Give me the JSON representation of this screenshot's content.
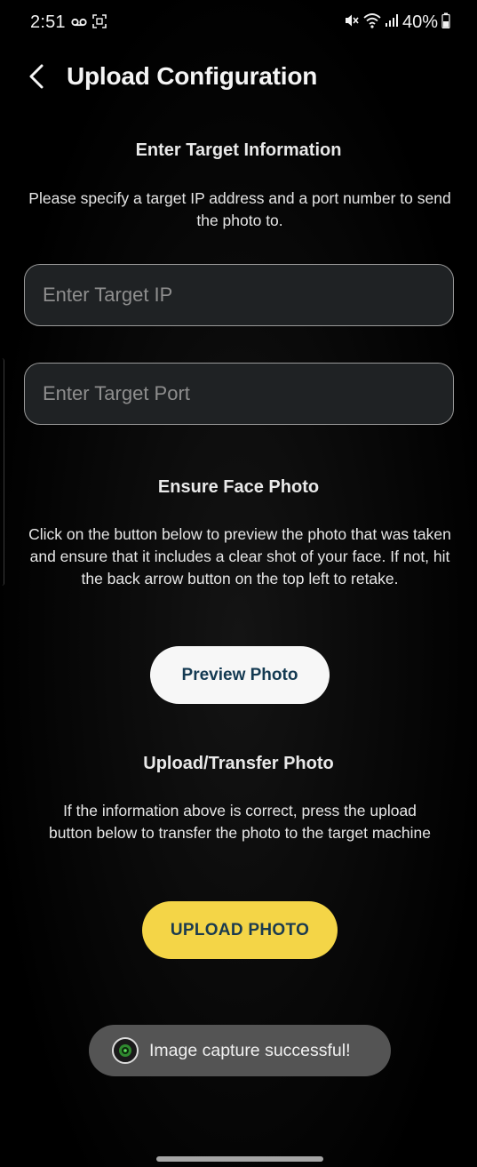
{
  "status_bar": {
    "time": "2:51",
    "battery": "40%",
    "icons": [
      "voicemail-icon",
      "screenshot-icon",
      "mute-icon",
      "wifi-icon",
      "signal-icon",
      "battery-icon"
    ]
  },
  "app_bar": {
    "title": "Upload Configuration",
    "back_icon": "back-arrow-icon"
  },
  "target_section": {
    "heading": "Enter Target Information",
    "description": "Please specify a target IP address and a port number to send the photo to.",
    "ip_input": {
      "placeholder": "Enter Target IP",
      "value": ""
    },
    "port_input": {
      "placeholder": "Enter Target Port",
      "value": ""
    }
  },
  "face_section": {
    "heading": "Ensure Face Photo",
    "description": "Click on the button below to preview the photo that was taken and ensure that it includes a clear shot of your face. If not, hit the back arrow button on the top left to retake.",
    "button_label": "Preview Photo"
  },
  "upload_section": {
    "heading": "Upload/Transfer Photo",
    "description": "If the information above is correct, press the upload button below to transfer the photo to the target machine",
    "button_label": "UPLOAD PHOTO"
  },
  "toast": {
    "message": "Image capture successful!",
    "icon": "camera-app-icon"
  },
  "colors": {
    "background": "#000000",
    "input_fill": "#1f2224",
    "preview_button": "#f7f7f7",
    "upload_button": "#f4d547",
    "button_text": "#143a52",
    "toast": "#545454"
  }
}
